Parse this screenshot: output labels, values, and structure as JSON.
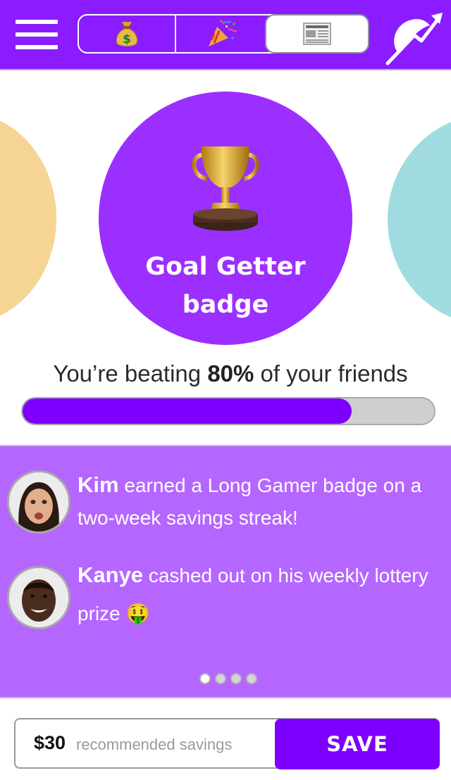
{
  "header": {
    "menu_icon": "hamburger-menu-icon",
    "segments": [
      {
        "icon": "money-bag-icon",
        "selected": false
      },
      {
        "icon": "party-popper-icon",
        "selected": false
      },
      {
        "icon": "newspaper-icon",
        "selected": true
      }
    ],
    "trend_icon": "rocket-trend-arrow-icon"
  },
  "carousel": {
    "left_color": "#f6d494",
    "right_color": "#a0dcdf",
    "badge": {
      "icon": "trophy-icon",
      "color": "#9b2fff",
      "title": "Goal Getter\nbadge"
    }
  },
  "progress": {
    "prefix": "You’re beating ",
    "percent_label": "80%",
    "suffix": " of your friends",
    "fraction": 0.8
  },
  "feed": {
    "items": [
      {
        "name": "Kim",
        "text": " earned a Long Gamer badge on a two-week savings streak!"
      },
      {
        "name": "Kanye",
        "text": " cashed out on his weekly lottery prize ",
        "emoji": "🤑"
      }
    ],
    "dots": {
      "count": 4,
      "active_index": 0
    }
  },
  "savebar": {
    "amount": "$30",
    "label": "recommended savings",
    "button": "SAVE"
  },
  "colors": {
    "header": "#8a1cff",
    "accent": "#7d00ff",
    "feed_bg": "#b566ff"
  }
}
